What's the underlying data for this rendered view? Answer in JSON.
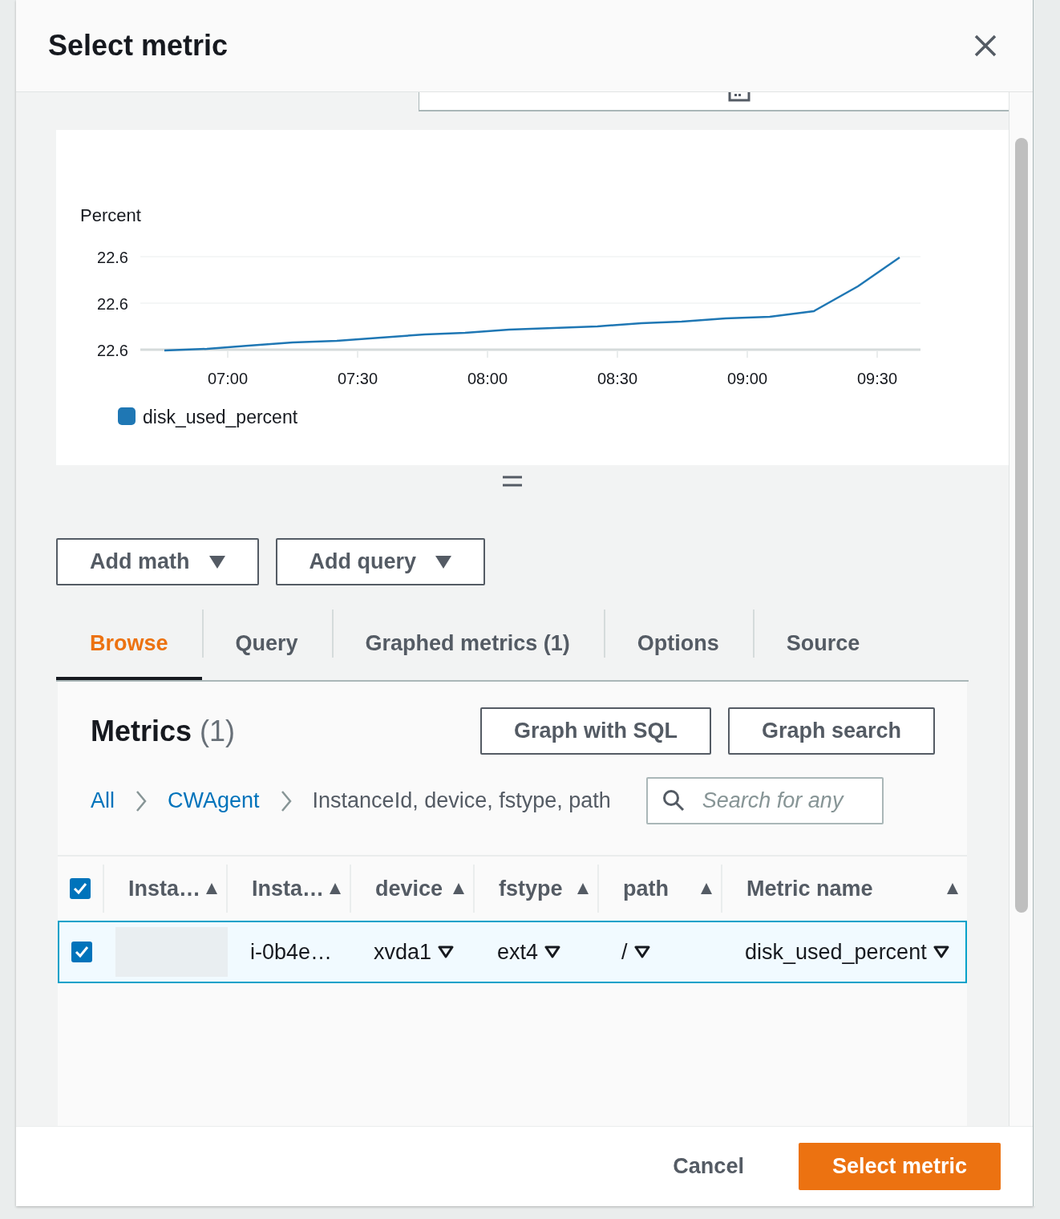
{
  "dialog": {
    "title": "Select metric"
  },
  "chart": {
    "ylabel": "Percent",
    "y_tick_labels": [
      "22.6",
      "22.6",
      "22.6"
    ],
    "x_tick_labels": [
      "07:00",
      "07:30",
      "08:00",
      "08:30",
      "09:00",
      "09:30"
    ],
    "legend": [
      {
        "label": "disk_used_percent",
        "color": "#1f77b4"
      }
    ]
  },
  "toolbar_buttons": [
    {
      "label": "Add math"
    },
    {
      "label": "Add query"
    }
  ],
  "tabs": [
    {
      "label": "Browse",
      "selected": true
    },
    {
      "label": "Query",
      "selected": false
    },
    {
      "label": "Graphed metrics (1)",
      "selected": false
    },
    {
      "label": "Options",
      "selected": false
    },
    {
      "label": "Source",
      "selected": false
    }
  ],
  "metrics": {
    "title": "Metrics",
    "count": "(1)",
    "buttons": [
      "Graph with SQL",
      "Graph search"
    ],
    "breadcrumbs": [
      {
        "label": "All",
        "kind": "link"
      },
      {
        "label": "CWAgent",
        "kind": "link"
      },
      {
        "label": "InstanceId, device, fstype, path",
        "kind": "current"
      }
    ],
    "search": {
      "placeholder": "Search for any"
    }
  },
  "table": {
    "select_all_checked": true,
    "columns": [
      {
        "label": "Insta…"
      },
      {
        "label": "Insta…"
      },
      {
        "label": "device"
      },
      {
        "label": "fstype"
      },
      {
        "label": "path"
      },
      {
        "label": "Metric name"
      }
    ],
    "rows": [
      {
        "checked": true,
        "selected": true,
        "cells": [
          {
            "kind": "redacted"
          },
          {
            "kind": "text",
            "text": "i-0b4e…"
          },
          {
            "kind": "filter",
            "text": "xvda1"
          },
          {
            "kind": "filter",
            "text": "ext4"
          },
          {
            "kind": "filter",
            "text": "/"
          },
          {
            "kind": "filter",
            "text": "disk_used_percent"
          }
        ]
      }
    ]
  },
  "footer": {
    "buttons": [
      {
        "label": "Cancel",
        "kind": "link"
      },
      {
        "label": "Select metric",
        "kind": "primary"
      }
    ]
  }
}
